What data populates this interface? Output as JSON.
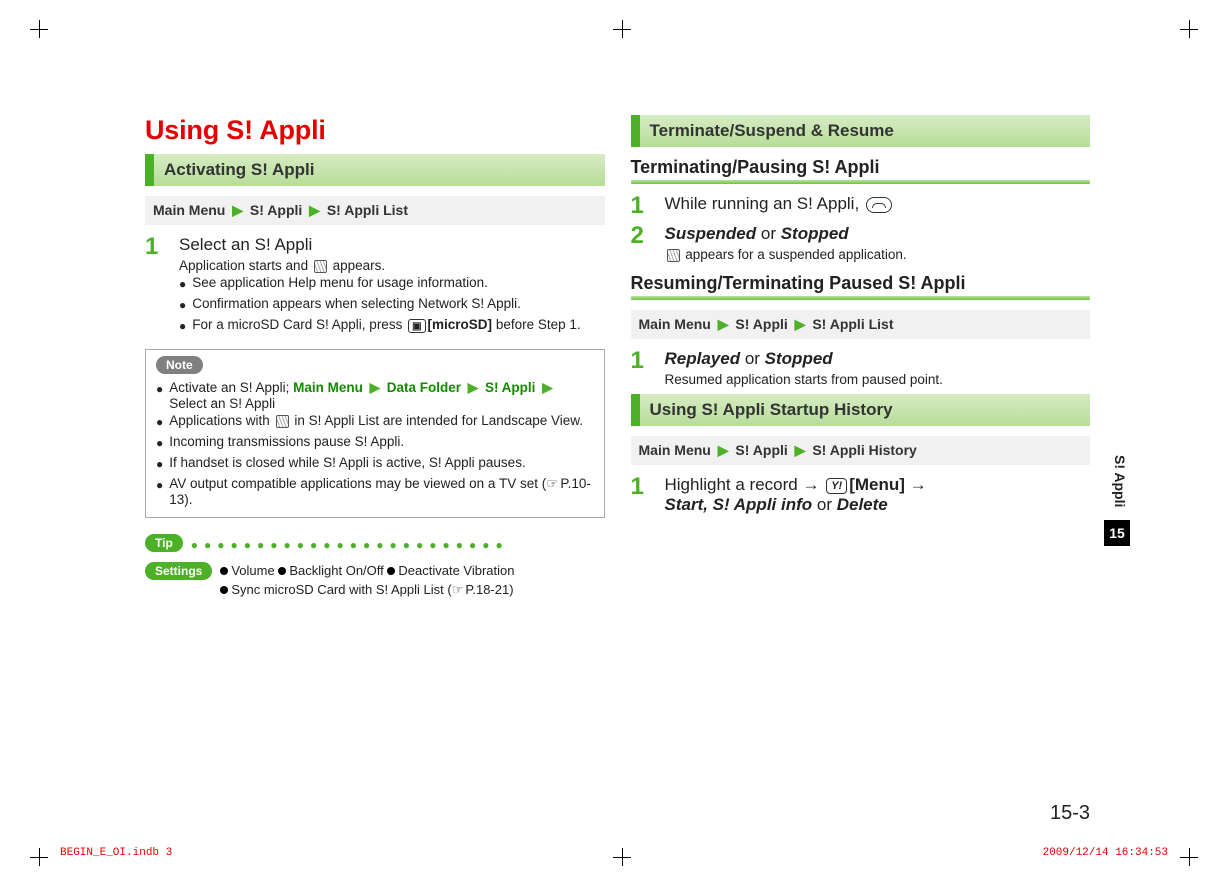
{
  "page": {
    "title": "Using S! Appli",
    "side_tab": "S! Appli",
    "chapter_number": "15",
    "page_number": "15-3"
  },
  "left": {
    "h2": "Activating S! Appli",
    "crumb": {
      "root": "Main Menu",
      "l1": "S! Appli",
      "l2": "S! Appli List"
    },
    "step1": {
      "num": "1",
      "main": "Select an S! Appli",
      "sub1": "Application starts and ",
      "sub1b": " appears.",
      "b1": "See application Help menu for usage information.",
      "b2": "Confirmation appears when selecting Network S! Appli.",
      "b3a": "For a microSD Card S! Appli, press ",
      "b3key": "[microSD]",
      "b3b": " before Step 1."
    },
    "note": {
      "label": "Note",
      "n1a": "Activate an S! Appli; ",
      "n1_root": "Main Menu",
      "n1_l1": "Data Folder",
      "n1_l2": "S! Appli",
      "n1b": "Select an S! Appli",
      "n2a": "Applications with ",
      "n2b": " in S! Appli List are intended for Landscape View.",
      "n3": "Incoming transmissions pause S! Appli.",
      "n4": "If handset is closed while S! Appli is active, S! Appli pauses.",
      "n5a": "AV output compatible applications may be viewed on a TV set (",
      "n5ref": "P.10-13",
      "n5b": ")."
    },
    "tip": {
      "label": "Tip",
      "settings_label": "Settings",
      "s1": "Volume",
      "s2": "Backlight On/Off",
      "s3": "Deactivate Vibration",
      "s4a": "Sync microSD Card with S! Appli List (",
      "s4ref": "P.18-21",
      "s4b": ")"
    }
  },
  "right": {
    "h2a": "Terminate/Suspend & Resume",
    "h3a": "Terminating/Pausing S! Appli",
    "r1": {
      "num": "1",
      "text": "While running an S! Appli, "
    },
    "r2": {
      "num": "2",
      "a": "Suspended",
      "or": " or ",
      "b": "Stopped",
      "sub": " appears for a suspended application."
    },
    "h3b": "Resuming/Terminating Paused S! Appli",
    "crumb2": {
      "root": "Main Menu",
      "l1": "S! Appli",
      "l2": "S! Appli List"
    },
    "r3": {
      "num": "1",
      "a": "Replayed",
      "or": " or ",
      "b": "Stopped",
      "sub": "Resumed application starts from paused point."
    },
    "h2b": "Using S! Appli Startup History",
    "crumb3": {
      "root": "Main Menu",
      "l1": "S! Appli",
      "l2": "S! Appli History"
    },
    "r4": {
      "num": "1",
      "t1": "Highlight a record ",
      "arrow": "→",
      "menu": "[Menu]",
      "t2a": "Start, S! Appli info",
      "or": " or ",
      "t2b": "Delete"
    }
  },
  "footer": {
    "left": "BEGIN_E_OI.indb   3",
    "right": "2009/12/14   16:34:53"
  }
}
